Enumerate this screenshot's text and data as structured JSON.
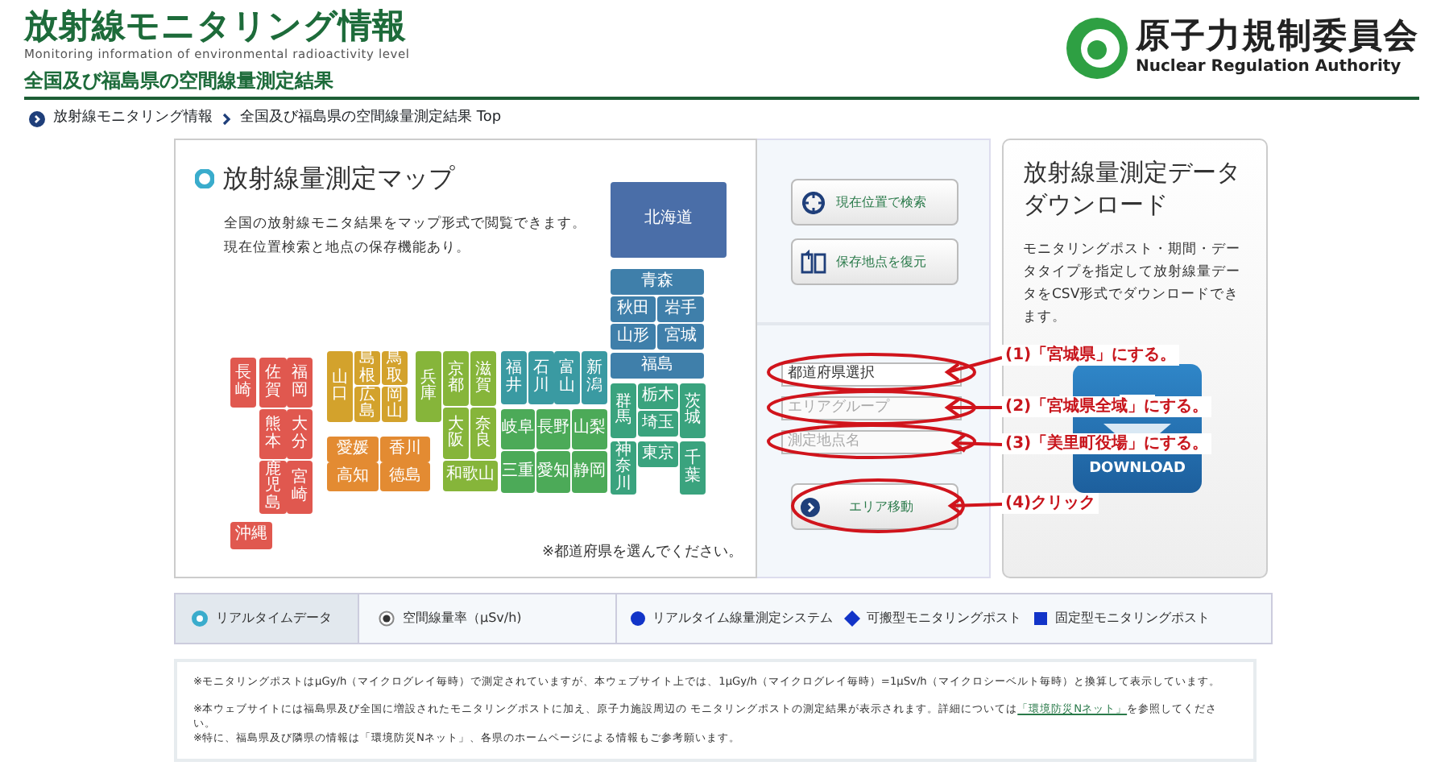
{
  "header": {
    "title": "放射線モニタリング情報",
    "subtitle": "Monitoring information of environmental radioactivity level",
    "heading": "全国及び福島県の空間線量測定結果"
  },
  "logo": {
    "name_ja": "原子力規制委員会",
    "name_en": "Nuclear Regulation Authority"
  },
  "breadcrumb": [
    "放射線モニタリング情報",
    "全国及び福島県の空間線量測定結果 Top"
  ],
  "map_panel": {
    "title": "放射線量測定マップ",
    "description": [
      "全国の放射線モニタ結果をマップ形式で閲覧できます。",
      "現在位置検索と地点の保存機能あり。"
    ],
    "note": "※都道府県を選んでください。",
    "prefectures": [
      {
        "name": "北海道",
        "color": "#4a6ea8"
      },
      {
        "name": "青森",
        "color": "#3f7faa"
      },
      {
        "name": "秋田",
        "color": "#3f7faa"
      },
      {
        "name": "岩手",
        "color": "#3f7faa"
      },
      {
        "name": "山形",
        "color": "#3f7faa"
      },
      {
        "name": "宮城",
        "color": "#3f7faa"
      },
      {
        "name": "福島",
        "color": "#3f7faa"
      },
      {
        "name": "群馬",
        "color": "#3aa37e"
      },
      {
        "name": "栃木",
        "color": "#3aa37e"
      },
      {
        "name": "埼玉",
        "color": "#3aa37e"
      },
      {
        "name": "茨城",
        "color": "#3aa37e"
      },
      {
        "name": "神奈川",
        "color": "#3aa37e"
      },
      {
        "name": "東京",
        "color": "#3aa37e"
      },
      {
        "name": "千葉",
        "color": "#3aa37e"
      },
      {
        "name": "福井",
        "color": "#3a9aa2"
      },
      {
        "name": "石川",
        "color": "#3a9aa2"
      },
      {
        "name": "富山",
        "color": "#3a9aa2"
      },
      {
        "name": "新潟",
        "color": "#3a9aa2"
      },
      {
        "name": "岐阜",
        "color": "#4caa58"
      },
      {
        "name": "長野",
        "color": "#4caa58"
      },
      {
        "name": "山梨",
        "color": "#4caa58"
      },
      {
        "name": "三重",
        "color": "#4caa58"
      },
      {
        "name": "愛知",
        "color": "#4caa58"
      },
      {
        "name": "静岡",
        "color": "#4caa58"
      },
      {
        "name": "兵庫",
        "color": "#86b53a"
      },
      {
        "name": "京都",
        "color": "#86b53a"
      },
      {
        "name": "滋賀",
        "color": "#86b53a"
      },
      {
        "name": "大阪",
        "color": "#86b53a"
      },
      {
        "name": "奈良",
        "color": "#86b53a"
      },
      {
        "name": "和歌山",
        "color": "#86b53a"
      },
      {
        "name": "山口",
        "color": "#d3a22c"
      },
      {
        "name": "島根",
        "color": "#d3a22c"
      },
      {
        "name": "鳥取",
        "color": "#d3a22c"
      },
      {
        "name": "広島",
        "color": "#d3a22c"
      },
      {
        "name": "岡山",
        "color": "#d3a22c"
      },
      {
        "name": "愛媛",
        "color": "#e38b32"
      },
      {
        "name": "香川",
        "color": "#e38b32"
      },
      {
        "name": "高知",
        "color": "#e38b32"
      },
      {
        "name": "徳島",
        "color": "#e38b32"
      },
      {
        "name": "長崎",
        "color": "#e0584f"
      },
      {
        "name": "佐賀",
        "color": "#e0584f"
      },
      {
        "name": "福岡",
        "color": "#e0584f"
      },
      {
        "name": "熊本",
        "color": "#e0584f"
      },
      {
        "name": "大分",
        "color": "#e0584f"
      },
      {
        "name": "鹿児島",
        "color": "#e0584f"
      },
      {
        "name": "宮崎",
        "color": "#e0584f"
      },
      {
        "name": "沖縄",
        "color": "#e0584f"
      }
    ]
  },
  "controls": {
    "buttons": [
      {
        "label": "現在位置で検索",
        "kind": "locate"
      },
      {
        "label": "保存地点を復元",
        "kind": "restore"
      }
    ],
    "fields": [
      {
        "value": "都道府県選択",
        "disabled": false
      },
      {
        "placeholder": "エリアグループ",
        "disabled": true
      },
      {
        "placeholder": "測定地点名",
        "disabled": true
      }
    ],
    "move_button": {
      "label": "エリア移動"
    }
  },
  "download": {
    "title": "放射線量測定データダウンロード",
    "description": "モニタリングポスト・期間・データタイプを指定して放射線量データをCSV形式でダウンロードできます。",
    "button_label": "DOWNLOAD"
  },
  "annotations": [
    {
      "label": "(1)「宮城県」にする。"
    },
    {
      "label": "(2)「宮城県全域」にする。"
    },
    {
      "label": "(3)「美里町役場」にする。"
    },
    {
      "label": "(4)クリック"
    }
  ],
  "data_bar": {
    "tabs": [
      {
        "label": "リアルタイムデータ",
        "selected": true
      }
    ],
    "mode": {
      "label": "空間線量率（μSv/h)",
      "checked": true
    },
    "legend": [
      {
        "label": "リアルタイム線量測定システム",
        "kind": "circle"
      },
      {
        "label": "可搬型モニタリングポスト",
        "kind": "diamond"
      },
      {
        "label": "固定型モニタリングポスト",
        "kind": "square"
      }
    ]
  },
  "notes": [
    {
      "text": "※モニタリングポストはμGy/h（マイクログレイ毎時）で測定されていますが、本ウェブサイト上では、1μGy/h（マイクログレイ毎時）=1μSv/h（マイクロシーベルト毎時）と換算して表示しています。"
    },
    {
      "text": "※本ウェブサイトには福島県及び全国に増設されたモニタリングポストに加え、原子力施設周辺の モニタリングポストの測定結果が表示されます。詳細については",
      "link": "「環境防災Nネット」",
      "after": "を参照してください。"
    },
    {
      "text": "※特に、福島県及び隣県の情報は「環境防災Nネット」、各県のホームページによる情報もご参考願います。"
    }
  ]
}
